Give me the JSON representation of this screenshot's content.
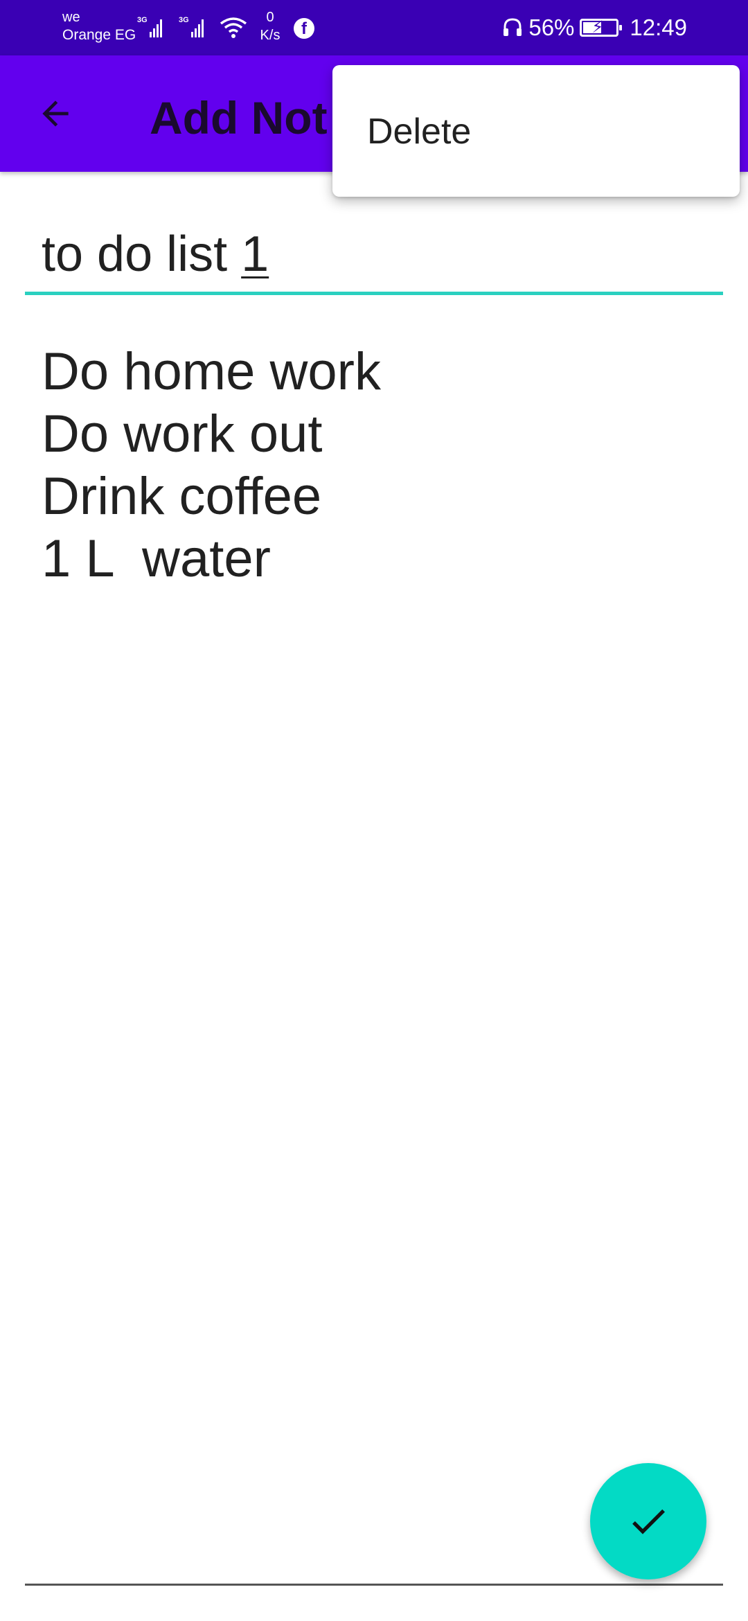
{
  "status_bar": {
    "carrier_top": "we",
    "carrier_bottom": "Orange EG",
    "network_1": "3G",
    "network_2": "3G",
    "speed_value": "0",
    "speed_unit": "K/s",
    "battery_percent": "56%",
    "battery_level": 0.56,
    "time": "12:49",
    "icons": [
      "signal-icon",
      "wifi-icon",
      "facebook-icon",
      "headset-icon",
      "battery-charging-icon"
    ]
  },
  "app_bar": {
    "title": "Add Not",
    "back_icon": "arrow-back-icon",
    "background": "#6200ee"
  },
  "popup_menu": {
    "items": [
      {
        "label": "Delete"
      }
    ]
  },
  "note": {
    "title_prefix": "to do list ",
    "title_underlined": "1",
    "body_lines": [
      "Do home work",
      "Do work out",
      "Drink coffee",
      "1 L  water"
    ]
  },
  "fab": {
    "icon": "check-icon",
    "color": "#03dac5"
  },
  "colors": {
    "status_bar": "#3a00b4",
    "accent": "#2ad0c0"
  }
}
